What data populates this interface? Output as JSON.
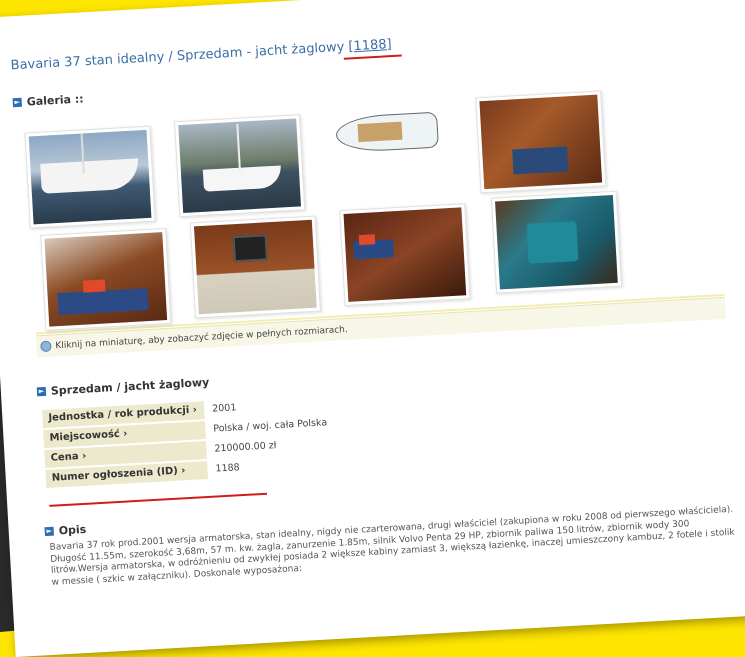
{
  "title": {
    "text": "Bavaria 37 stan idealny / Sprzedam - jacht żaglowy ",
    "id": "[1188]"
  },
  "gallery": {
    "heading": "Galeria ::",
    "thumbs": [
      {
        "name": "photo-boat-exterior"
      },
      {
        "name": "photo-boat-marina"
      },
      {
        "name": "photo-deck-plan"
      },
      {
        "name": "photo-cabin-saloon"
      },
      {
        "name": "photo-cabin-bunk"
      },
      {
        "name": "photo-nav-station"
      },
      {
        "name": "photo-cabin-table"
      },
      {
        "name": "photo-engine"
      }
    ],
    "hint": "Kliknij na miniaturę, aby zobaczyć zdjęcie w pełnych rozmiarach."
  },
  "info": {
    "heading": "Sprzedam / jacht żaglowy",
    "rows": [
      {
        "label": "Jednostka / rok produkcji ›",
        "value": "2001"
      },
      {
        "label": "Miejscowość ›",
        "value": "Polska / woj. cała Polska"
      },
      {
        "label": "Cena ›",
        "value": "210000.00 zł"
      },
      {
        "label": "Numer ogłoszenia (ID) ›",
        "value": "1188"
      }
    ]
  },
  "opis": {
    "heading": "Opis",
    "lines": [
      "Bavaria 37 rok prod.2001 wersja armatorska, stan idealny, nigdy nie czarterowana, drugi właściciel (zakupiona w roku 2008 od pierwszego właściciela).",
      "Długość 11.55m, szerokość 3,68m, 57 m. kw. żagla, zanurzenie 1.85m, silnik Volvo Penta 29 HP, zbiornik paliwa 150 litrów, zbiornik wody 300",
      "litrów.Wersja armatorska, w odróżnieniu od zwykłej posiada 2 większe kabiny zamiast 3, większą łazienkę, inaczej umieszczony kambuz, 2 fotele i stolik",
      "w messie ( szkic w załączniku). Doskonale wyposażona:"
    ]
  },
  "colors": {
    "background": "#ffe600",
    "link": "#3a6ea5",
    "accent_red": "#d01c1c",
    "label_bg": "#ece9cd"
  }
}
